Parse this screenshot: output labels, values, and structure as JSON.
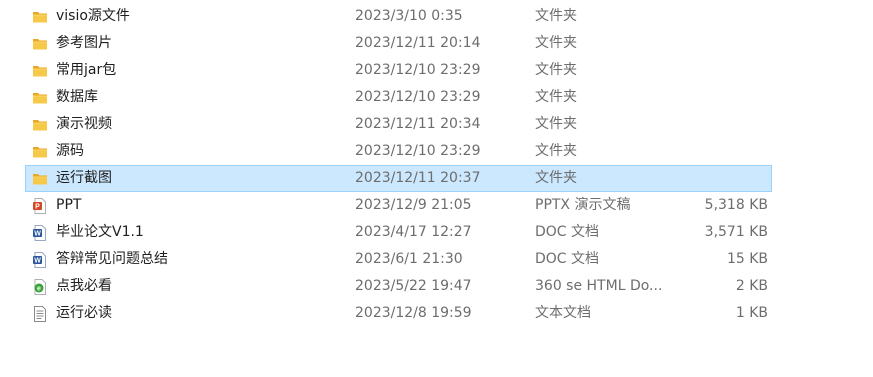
{
  "files": [
    {
      "icon": "folder-icon",
      "name": "visio源文件",
      "date": "2023/3/10 0:35",
      "type": "文件夹",
      "size": ""
    },
    {
      "icon": "folder-icon",
      "name": "参考图片",
      "date": "2023/12/11 20:14",
      "type": "文件夹",
      "size": ""
    },
    {
      "icon": "folder-icon",
      "name": "常用jar包",
      "date": "2023/12/10 23:29",
      "type": "文件夹",
      "size": ""
    },
    {
      "icon": "folder-icon",
      "name": "数据库",
      "date": "2023/12/10 23:29",
      "type": "文件夹",
      "size": ""
    },
    {
      "icon": "folder-icon",
      "name": "演示视频",
      "date": "2023/12/11 20:34",
      "type": "文件夹",
      "size": ""
    },
    {
      "icon": "folder-icon",
      "name": "源码",
      "date": "2023/12/10 23:29",
      "type": "文件夹",
      "size": ""
    },
    {
      "icon": "folder-icon",
      "name": "运行截图",
      "date": "2023/12/11 20:37",
      "type": "文件夹",
      "size": "",
      "selected": true
    },
    {
      "icon": "pptx-icon",
      "name": "PPT",
      "date": "2023/12/9 21:05",
      "type": "PPTX 演示文稿",
      "size": "5,318 KB"
    },
    {
      "icon": "word-doc-icon",
      "name": "毕业论文V1.1",
      "date": "2023/4/17 12:27",
      "type": "DOC 文档",
      "size": "3,571 KB"
    },
    {
      "icon": "word-doc-icon",
      "name": "答辩常见问题总结",
      "date": "2023/6/1 21:30",
      "type": "DOC 文档",
      "size": "15 KB"
    },
    {
      "icon": "html-file-icon",
      "name": "点我必看",
      "date": "2023/5/22 19:47",
      "type": "360 se HTML Do...",
      "size": "2 KB"
    },
    {
      "icon": "text-file-icon",
      "name": "运行必读",
      "date": "2023/12/8 19:59",
      "type": "文本文档",
      "size": "1 KB"
    }
  ],
  "colors": {
    "folder": "#f5c043",
    "selection_bg": "#cce8ff",
    "selection_border": "#99d1ff",
    "pptx": "#d24726",
    "word": "#2b579a",
    "html": "#3aa335"
  }
}
